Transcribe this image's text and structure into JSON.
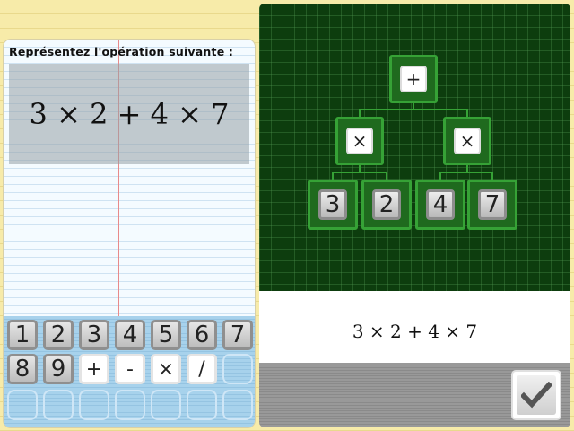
{
  "prompt": "Représentez l'opération suivante :",
  "expression": "3 × 2 + 4 × 7",
  "keypad": {
    "row1": [
      "1",
      "2",
      "3",
      "4",
      "5",
      "6",
      "7"
    ],
    "row2": [
      "8",
      "9",
      "+",
      "-",
      "×",
      "/"
    ]
  },
  "tree": {
    "root": "+",
    "left_op": "×",
    "right_op": "×",
    "leaves": [
      "3",
      "2",
      "4",
      "7"
    ]
  },
  "answer": "3 × 2 + 4 × 7",
  "colors": {
    "board": "#0d3d0e",
    "node_border": "#36a236",
    "margin_line": "#e88a8a"
  },
  "icons": {
    "validate": "checkmark-icon"
  }
}
